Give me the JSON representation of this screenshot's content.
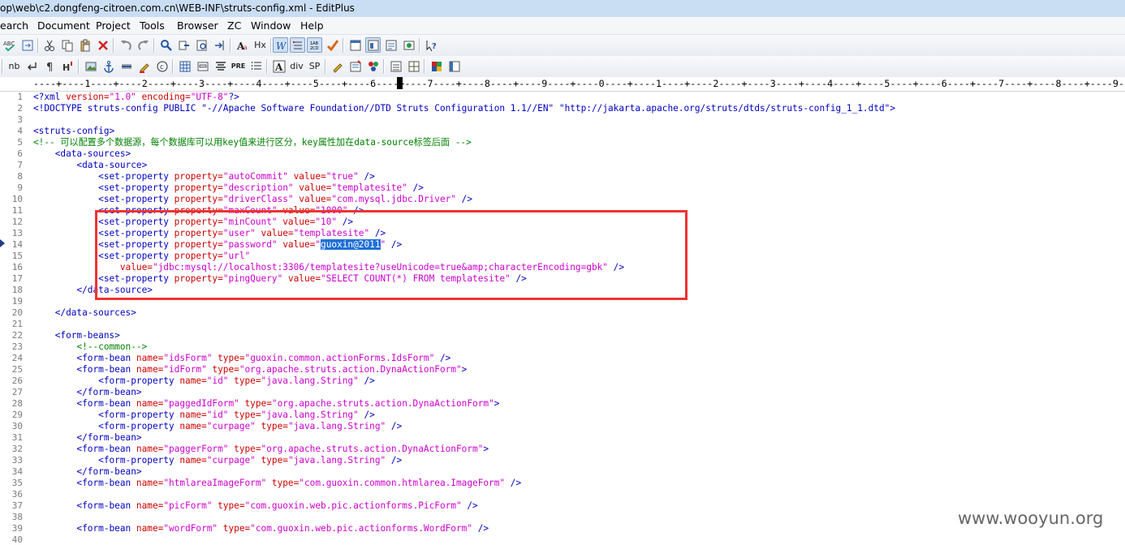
{
  "window": {
    "title": "op\\web\\c2.dongfeng-citroen.com.cn\\WEB-INF\\struts-config.xml - EditPlus"
  },
  "menu": [
    "earch",
    "Document",
    "Project",
    "Tools",
    "Browser",
    "ZC",
    "Window",
    "Help"
  ],
  "toolbar2_labels": {
    "nb": "nb",
    "hx": "Hx",
    "pre": "PRE",
    "div": "div",
    "sp": "SP"
  },
  "ruler": "----+----1----+----2----+----3----+----4----+----5----+----6----+----7----+----8----+----9----+----0----+----1----+----2----+----3----+----4----+----5----+----6----+----7----+----8----+----9--",
  "line_numbers": [
    "1",
    "2",
    "3",
    "4",
    "5",
    "6",
    "7",
    "8",
    "9",
    "10",
    "11",
    "12",
    "13",
    "14",
    "15",
    "16",
    "17",
    "18",
    "19",
    "20",
    "21",
    "22",
    "23",
    "24",
    "25",
    "26",
    "27",
    "28",
    "29",
    "30",
    "31",
    "32",
    "33",
    "34",
    "35",
    "36",
    "37",
    "38",
    "39",
    "40"
  ],
  "code_lines": [
    [
      {
        "t": "<?xml ",
        "c": "tag"
      },
      {
        "t": "version=",
        "c": "attr"
      },
      {
        "t": "\"1.0\"",
        "c": "val"
      },
      {
        "t": " encoding=",
        "c": "attr"
      },
      {
        "t": "\"UTF-8\"",
        "c": "val"
      },
      {
        "t": "?>",
        "c": "tag"
      }
    ],
    [
      {
        "t": "<!DOCTYPE struts-config PUBLIC ",
        "c": "tag"
      },
      {
        "t": "\"-//Apache Software Foundation//DTD Struts Configuration 1.1//EN\"",
        "c": "tag"
      },
      {
        "t": " ",
        "c": "tag"
      },
      {
        "t": "\"http://jakarta.apache.org/struts/dtds/struts-config_1_1.dtd\"",
        "c": "tag"
      },
      {
        "t": ">",
        "c": "tag"
      }
    ],
    [],
    [
      {
        "t": "<struts-config>",
        "c": "tag"
      }
    ],
    [
      {
        "t": "<!-- 可以配置多个数据源，每个数据库可以用key值来进行区分，key属性加在data-source标签后面 -->",
        "c": "cmt"
      }
    ],
    [
      {
        "t": "    <data-sources>",
        "c": "tag"
      }
    ],
    [
      {
        "t": "        <data-source>",
        "c": "tag"
      }
    ],
    [
      {
        "t": "            <set-property ",
        "c": "tag"
      },
      {
        "t": "property=",
        "c": "attr"
      },
      {
        "t": "\"autoCommit\"",
        "c": "val"
      },
      {
        "t": " value=",
        "c": "attr"
      },
      {
        "t": "\"true\"",
        "c": "val"
      },
      {
        "t": " />",
        "c": "tag"
      }
    ],
    [
      {
        "t": "            <set-property ",
        "c": "tag"
      },
      {
        "t": "property=",
        "c": "attr"
      },
      {
        "t": "\"description\"",
        "c": "val"
      },
      {
        "t": " value=",
        "c": "attr"
      },
      {
        "t": "\"templatesite\"",
        "c": "val"
      },
      {
        "t": " />",
        "c": "tag"
      }
    ],
    [
      {
        "t": "            <set-property ",
        "c": "tag"
      },
      {
        "t": "property=",
        "c": "attr"
      },
      {
        "t": "\"driverClass\"",
        "c": "val"
      },
      {
        "t": " value=",
        "c": "attr"
      },
      {
        "t": "\"com.mysql.jdbc.Driver\"",
        "c": "val"
      },
      {
        "t": " />",
        "c": "tag"
      }
    ],
    [
      {
        "t": "            <set-property ",
        "c": "tag"
      },
      {
        "t": "property=",
        "c": "attr"
      },
      {
        "t": "\"maxCount\"",
        "c": "val"
      },
      {
        "t": " value=",
        "c": "attr"
      },
      {
        "t": "\"1000\"",
        "c": "val"
      },
      {
        "t": " />",
        "c": "tag"
      }
    ],
    [
      {
        "t": "            <set-property ",
        "c": "tag"
      },
      {
        "t": "property=",
        "c": "attr"
      },
      {
        "t": "\"minCount\"",
        "c": "val"
      },
      {
        "t": " value=",
        "c": "attr"
      },
      {
        "t": "\"10\"",
        "c": "val"
      },
      {
        "t": " />",
        "c": "tag"
      }
    ],
    [
      {
        "t": "            <set-property ",
        "c": "tag"
      },
      {
        "t": "property=",
        "c": "attr"
      },
      {
        "t": "\"user\"",
        "c": "val"
      },
      {
        "t": " value=",
        "c": "attr"
      },
      {
        "t": "\"templatesite\"",
        "c": "val"
      },
      {
        "t": " />",
        "c": "tag"
      }
    ],
    [
      {
        "t": "            <set-property ",
        "c": "tag"
      },
      {
        "t": "property=",
        "c": "attr"
      },
      {
        "t": "\"password\"",
        "c": "val"
      },
      {
        "t": " value=",
        "c": "attr"
      },
      {
        "t": "\"",
        "c": "val"
      },
      {
        "t": "guoxin@2011",
        "c": "sel"
      },
      {
        "t": "\"",
        "c": "val"
      },
      {
        "t": " />",
        "c": "tag"
      }
    ],
    [
      {
        "t": "            <set-property ",
        "c": "tag"
      },
      {
        "t": "property=",
        "c": "attr"
      },
      {
        "t": "\"url\"",
        "c": "val"
      }
    ],
    [
      {
        "t": "                value=",
        "c": "attr"
      },
      {
        "t": "\"jdbc:mysql://localhost:3306/templatesite?useUnicode=true&amp;characterEncoding=gbk\"",
        "c": "val"
      },
      {
        "t": " />",
        "c": "tag"
      }
    ],
    [
      {
        "t": "            <set-property ",
        "c": "tag"
      },
      {
        "t": "property=",
        "c": "attr"
      },
      {
        "t": "\"pingQuery\"",
        "c": "val"
      },
      {
        "t": " value=",
        "c": "attr"
      },
      {
        "t": "\"SELECT COUNT(*) FROM templatesite\"",
        "c": "val"
      },
      {
        "t": " />",
        "c": "tag"
      }
    ],
    [
      {
        "t": "        </data-source>",
        "c": "tag"
      }
    ],
    [],
    [
      {
        "t": "    </data-sources>",
        "c": "tag"
      }
    ],
    [],
    [
      {
        "t": "    <form-beans>",
        "c": "tag"
      }
    ],
    [
      {
        "t": "        <!--common-->",
        "c": "cmt"
      }
    ],
    [
      {
        "t": "        <form-bean ",
        "c": "tag"
      },
      {
        "t": "name=",
        "c": "attr"
      },
      {
        "t": "\"idsForm\"",
        "c": "val"
      },
      {
        "t": " type=",
        "c": "attr"
      },
      {
        "t": "\"guoxin.common.actionForms.IdsForm\"",
        "c": "val"
      },
      {
        "t": " />",
        "c": "tag"
      }
    ],
    [
      {
        "t": "        <form-bean ",
        "c": "tag"
      },
      {
        "t": "name=",
        "c": "attr"
      },
      {
        "t": "\"idForm\"",
        "c": "val"
      },
      {
        "t": " type=",
        "c": "attr"
      },
      {
        "t": "\"org.apache.struts.action.DynaActionForm\"",
        "c": "val"
      },
      {
        "t": ">",
        "c": "tag"
      }
    ],
    [
      {
        "t": "            <form-property ",
        "c": "tag"
      },
      {
        "t": "name=",
        "c": "attr"
      },
      {
        "t": "\"id\"",
        "c": "val"
      },
      {
        "t": " type=",
        "c": "attr"
      },
      {
        "t": "\"java.lang.String\"",
        "c": "val"
      },
      {
        "t": " />",
        "c": "tag"
      }
    ],
    [
      {
        "t": "        </form-bean>",
        "c": "tag"
      }
    ],
    [
      {
        "t": "        <form-bean ",
        "c": "tag"
      },
      {
        "t": "name=",
        "c": "attr"
      },
      {
        "t": "\"paggedIdForm\"",
        "c": "val"
      },
      {
        "t": " type=",
        "c": "attr"
      },
      {
        "t": "\"org.apache.struts.action.DynaActionForm\"",
        "c": "val"
      },
      {
        "t": ">",
        "c": "tag"
      }
    ],
    [
      {
        "t": "            <form-property ",
        "c": "tag"
      },
      {
        "t": "name=",
        "c": "attr"
      },
      {
        "t": "\"id\"",
        "c": "val"
      },
      {
        "t": " type=",
        "c": "attr"
      },
      {
        "t": "\"java.lang.String\"",
        "c": "val"
      },
      {
        "t": " />",
        "c": "tag"
      }
    ],
    [
      {
        "t": "            <form-property ",
        "c": "tag"
      },
      {
        "t": "name=",
        "c": "attr"
      },
      {
        "t": "\"curpage\"",
        "c": "val"
      },
      {
        "t": " type=",
        "c": "attr"
      },
      {
        "t": "\"java.lang.String\"",
        "c": "val"
      },
      {
        "t": " />",
        "c": "tag"
      }
    ],
    [
      {
        "t": "        </form-bean>",
        "c": "tag"
      }
    ],
    [
      {
        "t": "        <form-bean ",
        "c": "tag"
      },
      {
        "t": "name=",
        "c": "attr"
      },
      {
        "t": "\"paggerForm\"",
        "c": "val"
      },
      {
        "t": " type=",
        "c": "attr"
      },
      {
        "t": "\"org.apache.struts.action.DynaActionForm\"",
        "c": "val"
      },
      {
        "t": ">",
        "c": "tag"
      }
    ],
    [
      {
        "t": "            <form-property ",
        "c": "tag"
      },
      {
        "t": "name=",
        "c": "attr"
      },
      {
        "t": "\"curpage\"",
        "c": "val"
      },
      {
        "t": " type=",
        "c": "attr"
      },
      {
        "t": "\"java.lang.String\"",
        "c": "val"
      },
      {
        "t": " />",
        "c": "tag"
      }
    ],
    [
      {
        "t": "        </form-bean>",
        "c": "tag"
      }
    ],
    [
      {
        "t": "        <form-bean ",
        "c": "tag"
      },
      {
        "t": "name=",
        "c": "attr"
      },
      {
        "t": "\"htmlareaImageForm\"",
        "c": "val"
      },
      {
        "t": " type=",
        "c": "attr"
      },
      {
        "t": "\"com.guoxin.common.htmlarea.ImageForm\"",
        "c": "val"
      },
      {
        "t": " />",
        "c": "tag"
      }
    ],
    [],
    [
      {
        "t": "        <form-bean ",
        "c": "tag"
      },
      {
        "t": "name=",
        "c": "attr"
      },
      {
        "t": "\"picForm\"",
        "c": "val"
      },
      {
        "t": " type=",
        "c": "attr"
      },
      {
        "t": "\"com.guoxin.web.pic.actionforms.PicForm\"",
        "c": "val"
      },
      {
        "t": " />",
        "c": "tag"
      }
    ],
    [],
    [
      {
        "t": "        <form-bean ",
        "c": "tag"
      },
      {
        "t": "name=",
        "c": "attr"
      },
      {
        "t": "\"wordForm\"",
        "c": "val"
      },
      {
        "t": " type=",
        "c": "attr"
      },
      {
        "t": "\"com.guoxin.web.pic.actionforms.WordForm\"",
        "c": "val"
      },
      {
        "t": " />",
        "c": "tag"
      }
    ],
    []
  ],
  "watermark": "www.wooyun.org",
  "colors": {
    "tag": "#0000c0",
    "attr": "#cc0000",
    "value": "#cc00cc",
    "comment": "#008000",
    "selection": "#1e6fd6",
    "highlight_box": "#ee3333"
  }
}
